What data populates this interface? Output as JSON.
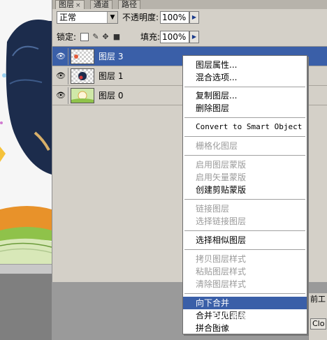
{
  "tabs": [
    {
      "label": "图层",
      "close": "×"
    },
    {
      "label": "通道"
    },
    {
      "label": "路径"
    }
  ],
  "blend_mode": {
    "value": "正常"
  },
  "opacity": {
    "label": "不透明度:",
    "value": "100%"
  },
  "lock": {
    "label": "锁定:"
  },
  "fill": {
    "label": "填充:",
    "value": "100%"
  },
  "layers": [
    {
      "name": "图层 3",
      "selected": true
    },
    {
      "name": "图层 1",
      "selected": false
    },
    {
      "name": "图层 0",
      "selected": false
    }
  ],
  "context_menu": {
    "items": [
      {
        "label": "图层属性...",
        "enabled": true
      },
      {
        "label": "混合选项...",
        "enabled": true
      },
      {
        "label": "复制图层...",
        "enabled": true
      },
      {
        "label": "删除图层",
        "enabled": true
      },
      {
        "label": "Convert to Smart Object",
        "enabled": true
      },
      {
        "label": "栅格化图层",
        "enabled": false
      },
      {
        "label": "启用图层蒙版",
        "enabled": false
      },
      {
        "label": "启用矢量蒙版",
        "enabled": false
      },
      {
        "label": "创建剪贴蒙版",
        "enabled": true
      },
      {
        "label": "链接图层",
        "enabled": false
      },
      {
        "label": "选择链接图层",
        "enabled": false
      },
      {
        "label": "选择相似图层",
        "enabled": true
      },
      {
        "label": "拷贝图层样式",
        "enabled": false
      },
      {
        "label": "粘贴图层样式",
        "enabled": false
      },
      {
        "label": "清除图层样式",
        "enabled": false
      },
      {
        "label": "向下合并",
        "enabled": true,
        "highlighted": true
      },
      {
        "label": "合并可见图层",
        "enabled": true
      },
      {
        "label": "拼合图像",
        "enabled": true
      }
    ]
  },
  "bottom_fragment": {
    "line1": "前工",
    "line2": "Clo"
  },
  "watermark": {
    "text": "系统之家"
  },
  "colors": {
    "selection": "#3a5fa8",
    "panel": "#d4d0c8"
  }
}
